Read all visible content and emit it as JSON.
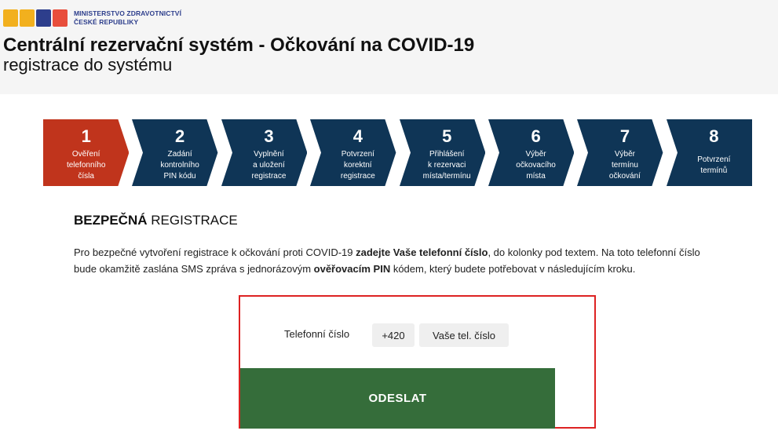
{
  "header": {
    "ministry_line1": "MINISTERSTVO ZDRAVOTNICTVÍ",
    "ministry_line2": "ČESKÉ REPUBLIKY",
    "title": "Centrální rezervační systém - Očkování na COVID-19",
    "subtitle": "registrace do systému",
    "logo_colors": [
      "#f2b01e",
      "#f2b01e",
      "#e84e3c",
      "#2d3e8c",
      "#e84e3c"
    ]
  },
  "steps": [
    {
      "num": "1",
      "lines": [
        "Ověření",
        "telefonního",
        "čísla"
      ],
      "active": true
    },
    {
      "num": "2",
      "lines": [
        "Zadání",
        "kontrolního",
        "PIN kódu"
      ],
      "active": false
    },
    {
      "num": "3",
      "lines": [
        "Vyplnění",
        "a uložení",
        "registrace"
      ],
      "active": false
    },
    {
      "num": "4",
      "lines": [
        "Potvrzení",
        "korektní",
        "registrace"
      ],
      "active": false
    },
    {
      "num": "5",
      "lines": [
        "Přihlášení",
        "k rezervaci",
        "místa/termínu"
      ],
      "active": false
    },
    {
      "num": "6",
      "lines": [
        "Výběr",
        "očkovacího",
        "místa"
      ],
      "active": false
    },
    {
      "num": "7",
      "lines": [
        "Výběr",
        "termínu",
        "očkování"
      ],
      "active": false
    },
    {
      "num": "8",
      "lines": [
        "Potvrzení",
        "termínů"
      ],
      "active": false
    }
  ],
  "colors": {
    "active": "#c0341c",
    "inactive": "#0f3556",
    "submit": "#356d3a",
    "form_border": "#dd2222"
  },
  "section": {
    "title_bold": "BEZPEČNÁ",
    "title_rest": " REGISTRACE",
    "para_1": "Pro bezpečné vytvoření registrace k očkování proti COVID-19 ",
    "para_bold_1": "zadejte Vaše telefonní číslo",
    "para_2": ", do kolonky pod textem. Na toto telefonní číslo bude okamžitě zaslána SMS zpráva s jednorázovým ",
    "para_bold_2": "ověřovacím PIN",
    "para_3": " kódem, který budete potřebovat v následujícím kroku."
  },
  "form": {
    "phone_label": "Telefonní číslo",
    "prefix": "+420",
    "phone_placeholder": "Vaše tel. číslo",
    "submit_label": "ODESLAT"
  }
}
